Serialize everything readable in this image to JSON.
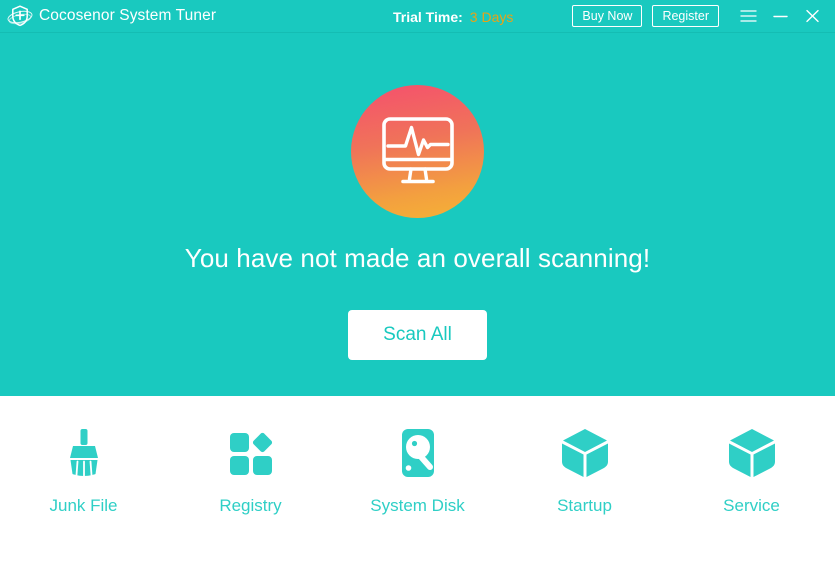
{
  "window": {
    "title": "Cocosenor System Tuner",
    "logo_icon": "shield-plus-logo-icon"
  },
  "titlebar": {
    "trial_label": "Trial Time:",
    "trial_value": "3 Days",
    "trial_value_color": "#e8a317",
    "buy_now_label": "Buy Now",
    "register_label": "Register",
    "menu_icon": "hamburger-menu-icon",
    "minimize_icon": "minimize-icon",
    "close_icon": "close-icon",
    "background_color": "#19c9bf"
  },
  "hero": {
    "status_icon": "monitor-pulse-icon",
    "status_icon_gradient_from": "#f4536a",
    "status_icon_gradient_to": "#f5b335",
    "message": "You have not made an overall scanning!",
    "scan_button_label": "Scan All",
    "background_color": "#19c9bf"
  },
  "tools": {
    "accent_color": "#2fcfc6",
    "items": [
      {
        "label": "Junk File",
        "icon": "broom-icon"
      },
      {
        "label": "Registry",
        "icon": "registry-blocks-icon"
      },
      {
        "label": "System Disk",
        "icon": "hard-disk-icon"
      },
      {
        "label": "Startup",
        "icon": "cube-icon"
      },
      {
        "label": "Service",
        "icon": "cube-icon"
      }
    ]
  }
}
